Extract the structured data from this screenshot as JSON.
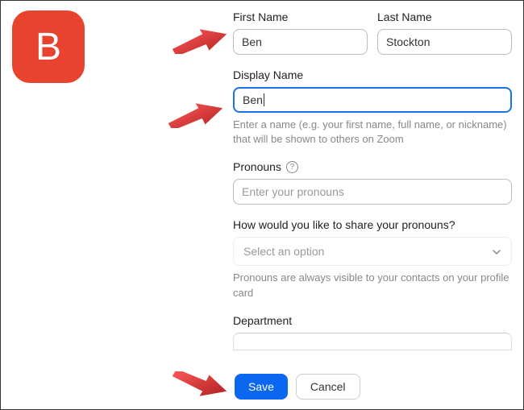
{
  "avatar": {
    "letter": "B"
  },
  "firstName": {
    "label": "First Name",
    "value": "Ben"
  },
  "lastName": {
    "label": "Last Name",
    "value": "Stockton"
  },
  "displayName": {
    "label": "Display Name",
    "value": "Ben",
    "help": "Enter a name (e.g. your first name, full name, or nickname) that will be shown to others on Zoom"
  },
  "pronouns": {
    "label": "Pronouns",
    "placeholder": "Enter your pronouns"
  },
  "sharePronouns": {
    "label": "How would you like to share your pronouns?",
    "selected": "Select an option",
    "help": "Pronouns are always visible to your contacts on your profile card"
  },
  "department": {
    "label": "Department"
  },
  "buttons": {
    "save": "Save",
    "cancel": "Cancel"
  }
}
